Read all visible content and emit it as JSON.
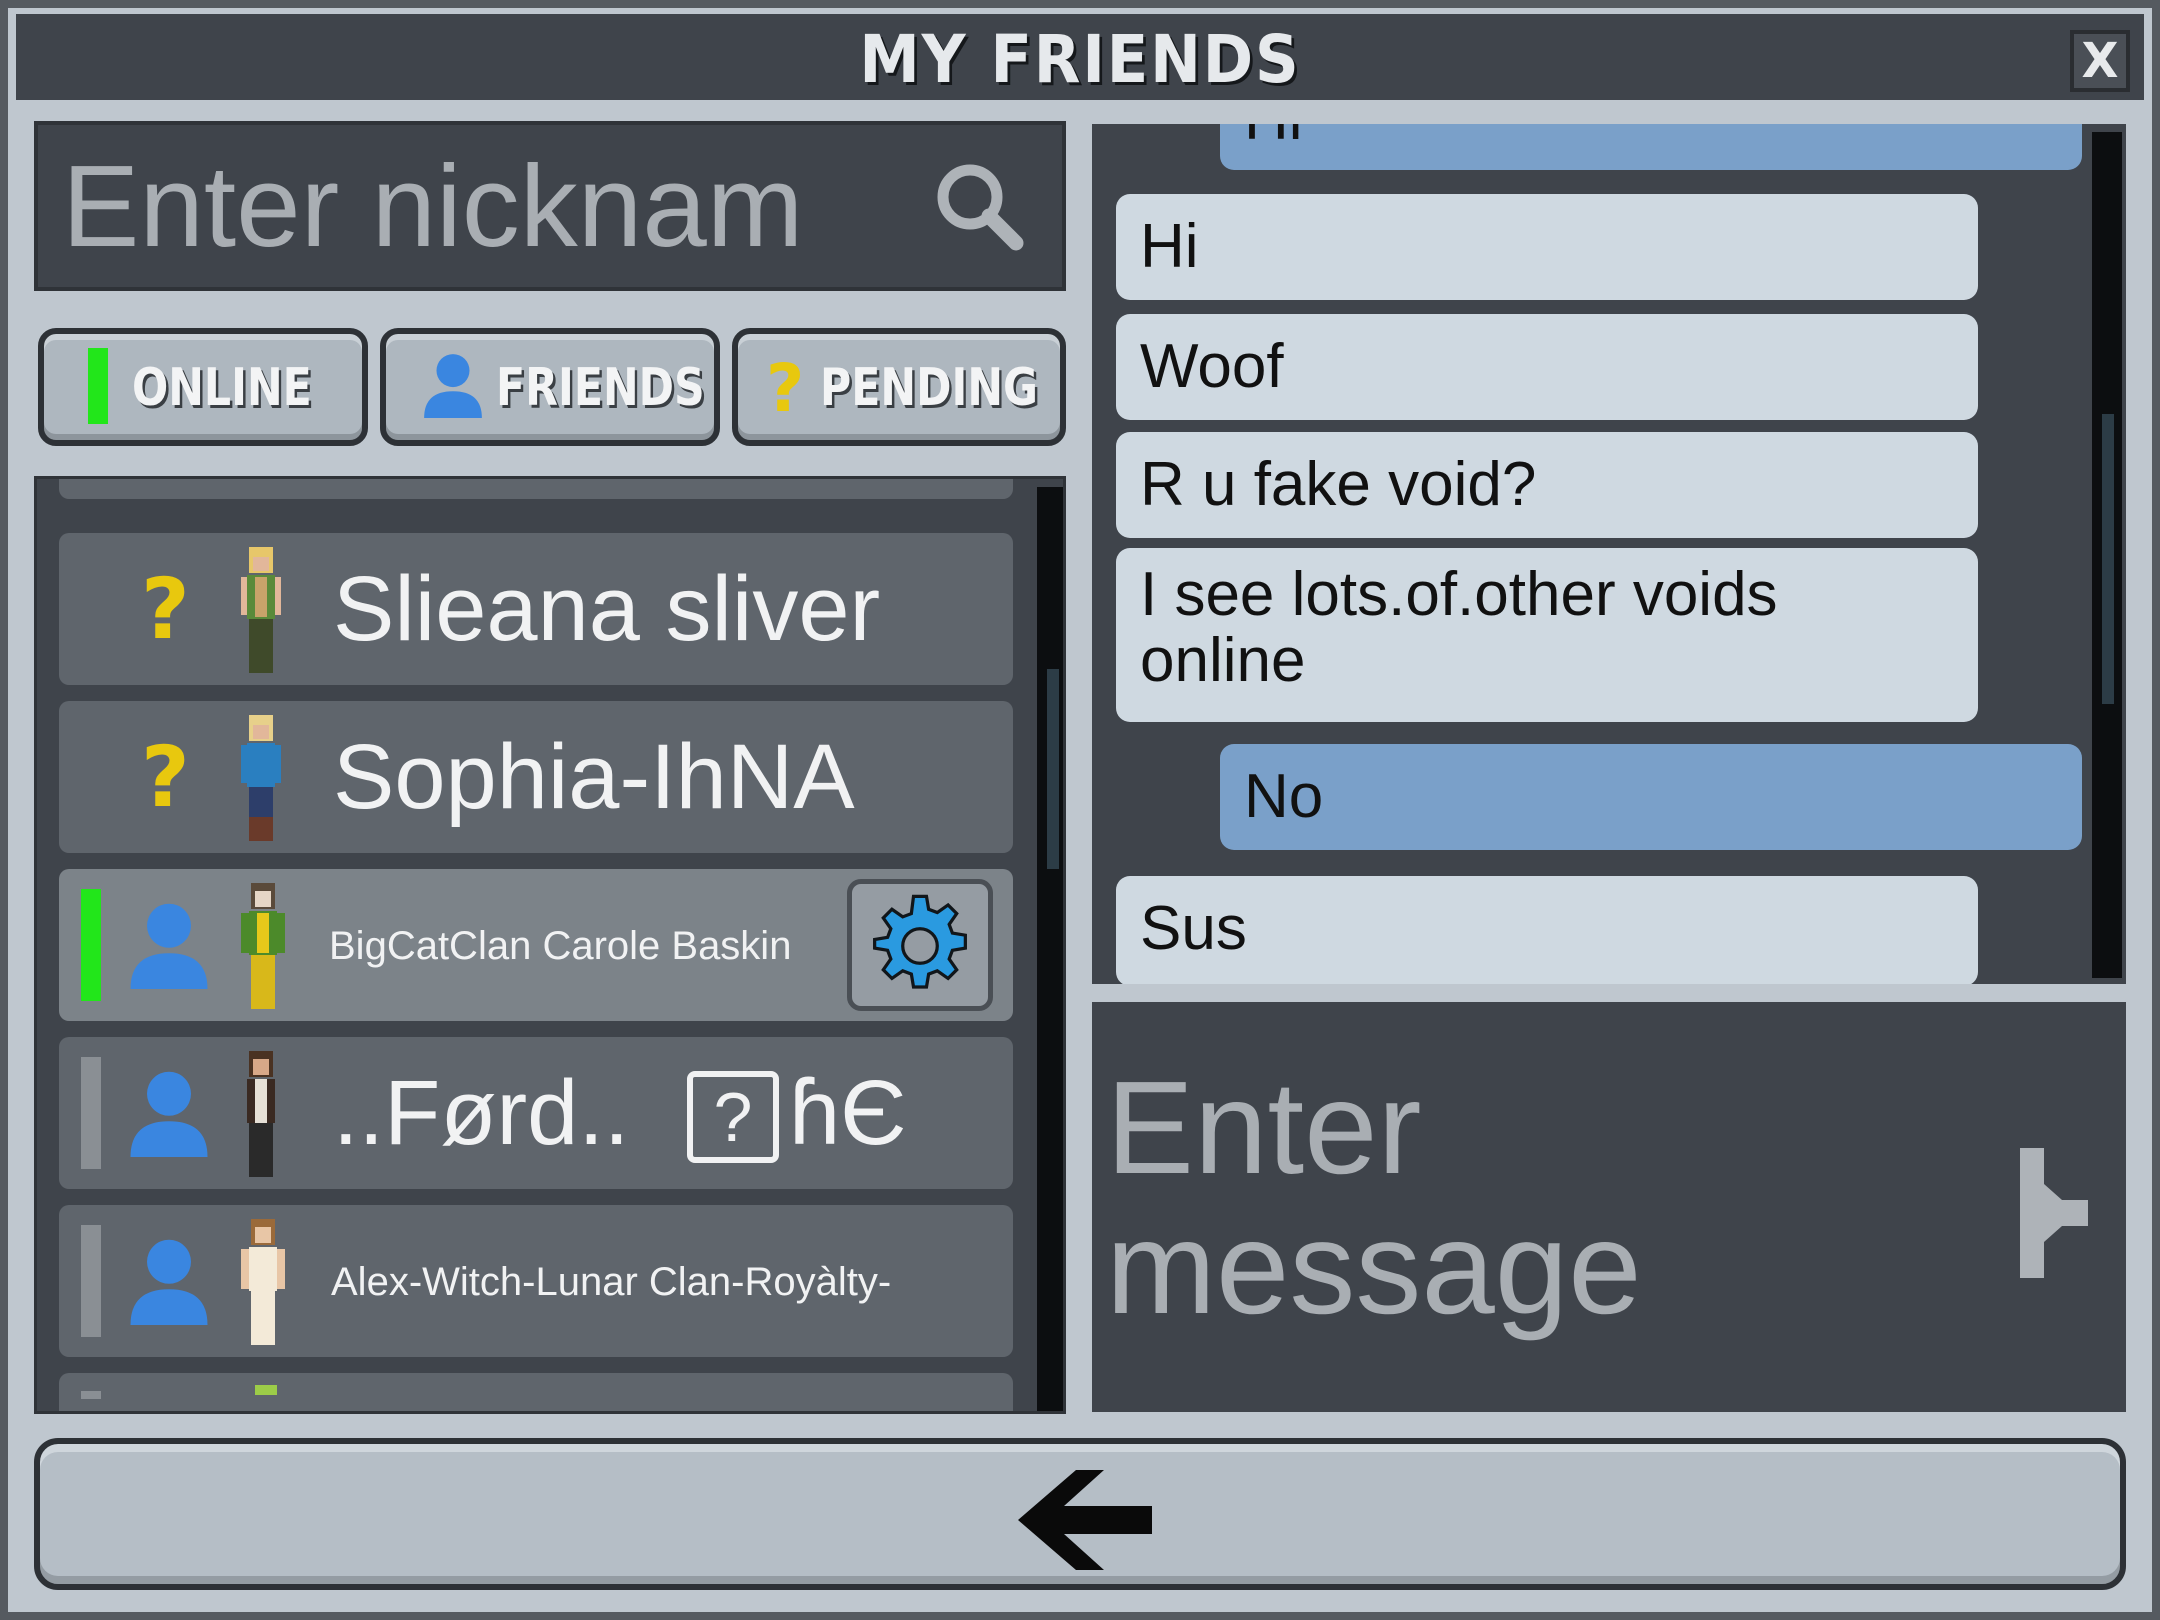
{
  "window": {
    "title": "MY FRIENDS",
    "close_label": "X"
  },
  "search": {
    "placeholder": "Enter nicknam",
    "icon": "search-icon"
  },
  "tabs": [
    {
      "label": "ONLINE",
      "icon": "online-status-bar-icon"
    },
    {
      "label": "FRIENDS",
      "icon": "person-icon"
    },
    {
      "label": "PENDING",
      "icon": "question-mark-icon"
    }
  ],
  "friends": [
    {
      "name": "",
      "type": "partial"
    },
    {
      "name": "Slieana sliver",
      "status": "pending",
      "icon": "question-mark-icon"
    },
    {
      "name": "Sophia-IhNA",
      "status": "pending",
      "icon": "question-mark-icon"
    },
    {
      "name": "BigCatClan Carole Baskin",
      "status": "online",
      "icon": "person-icon",
      "selected": true,
      "settings_icon": "gear-icon"
    },
    {
      "name": "..Førd.. ",
      "name_badge": "?",
      "name_suffix": "ɦЄ",
      "status": "offline",
      "icon": "person-icon"
    },
    {
      "name": "Alex-Witch-Lunar Clan-Royàlty-",
      "status": "offline",
      "icon": "person-icon"
    },
    {
      "name": "",
      "type": "partial"
    }
  ],
  "chat": {
    "messages": [
      {
        "text": "Hi",
        "from": "self",
        "partial": true
      },
      {
        "text": "Hi",
        "from": "other"
      },
      {
        "text": "Woof",
        "from": "other"
      },
      {
        "text": "R u fake void?",
        "from": "other"
      },
      {
        "text": "I see lots.of.other voids online",
        "from": "other"
      },
      {
        "text": "No",
        "from": "self"
      },
      {
        "text": "Sus",
        "from": "other"
      }
    ]
  },
  "message_input": {
    "placeholder": "Enter message",
    "send_icon": "send-icon"
  },
  "back_button": {
    "icon": "back-arrow-icon"
  },
  "colors": {
    "online": "#22e61a",
    "offline": "#8a8f94",
    "pending": "#e8c80e",
    "person": "#3a86e0",
    "self_bubble": "#7aa0c9",
    "other_bubble": "#cfd9e1"
  }
}
